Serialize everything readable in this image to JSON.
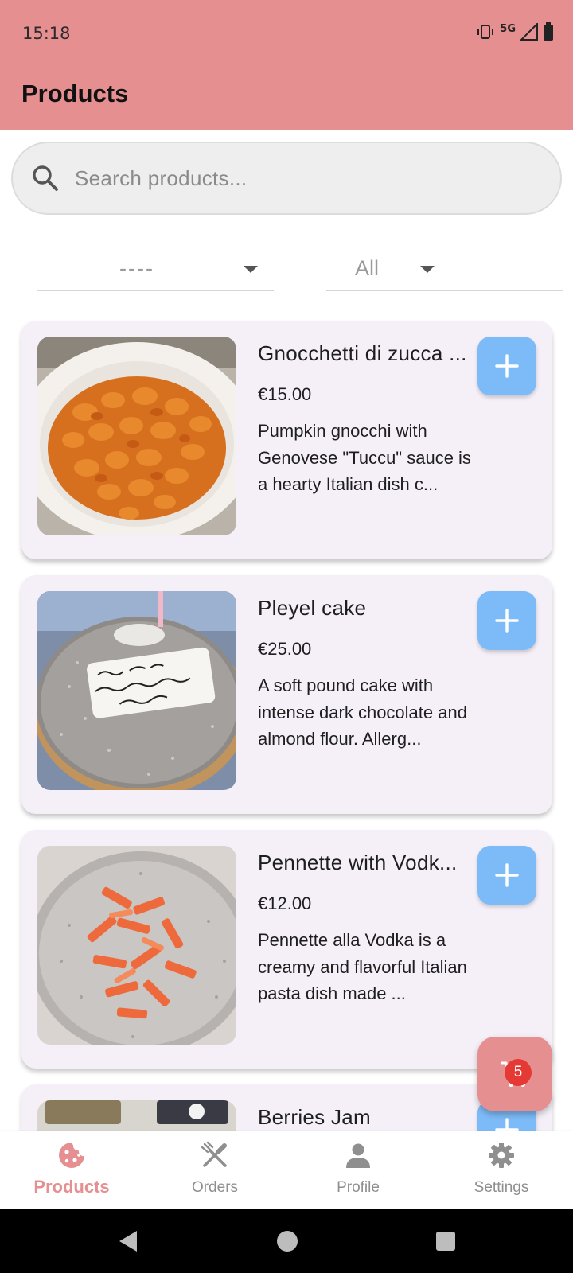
{
  "status_bar": {
    "time": "15:18",
    "network": "5G"
  },
  "header": {
    "title": "Products"
  },
  "search": {
    "placeholder": "Search products..."
  },
  "filters": {
    "category_value": "----",
    "type_value": "All"
  },
  "products": [
    {
      "name": "Gnocchetti di zucca ...",
      "price": "€15.00",
      "description": "Pumpkin gnocchi with Genovese \"Tuccu\" sauce is a hearty Italian dish c..."
    },
    {
      "name": "Pleyel cake",
      "price": "€25.00",
      "description": "A soft pound cake with intense dark chocolate and almond flour. Allerg..."
    },
    {
      "name": "Pennette with Vodk...",
      "price": "€12.00",
      "description": "Pennette alla Vodka is a creamy and flavorful Italian pasta dish made ..."
    },
    {
      "name": "Berries Jam",
      "price": "",
      "description": ""
    }
  ],
  "cart": {
    "count": "5"
  },
  "bottom_nav": [
    {
      "label": "Products",
      "icon": "cookie-icon",
      "active": true
    },
    {
      "label": "Orders",
      "icon": "utensils-icon",
      "active": false
    },
    {
      "label": "Profile",
      "icon": "person-icon",
      "active": false
    },
    {
      "label": "Settings",
      "icon": "gear-icon",
      "active": false
    }
  ],
  "colors": {
    "primary": "#e58f91",
    "add_button": "#7dbbf8",
    "card_background": "#f5eff8",
    "badge": "#e53935"
  }
}
